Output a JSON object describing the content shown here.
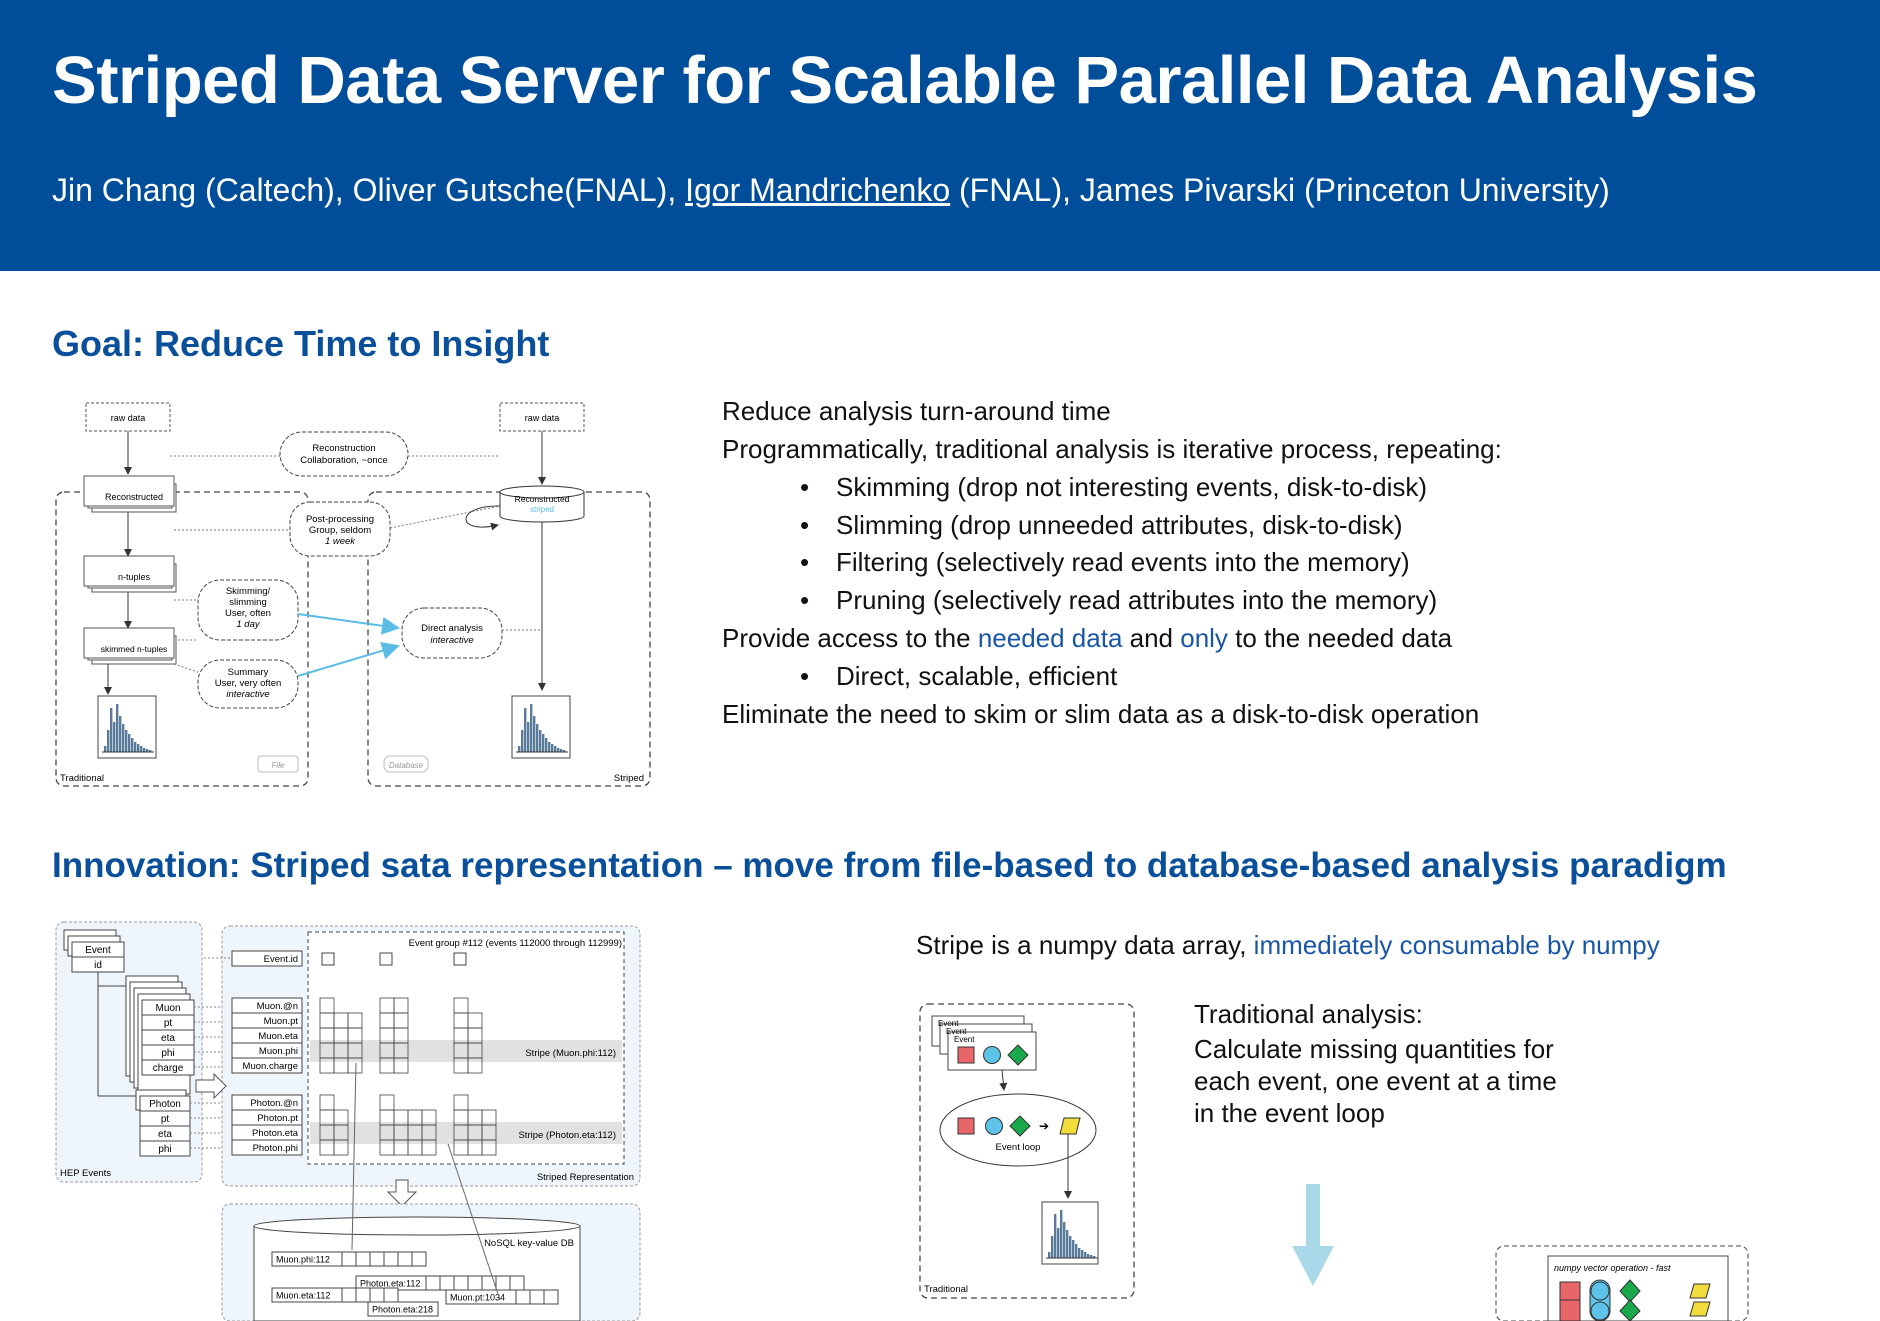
{
  "header": {
    "title": "Striped Data Server for Scalable Parallel Data Analysis",
    "authors_pre": "Jin Chang (Caltech), Oliver Gutsche(FNAL), ",
    "authors_presenter": "Igor Mandrichenko",
    "authors_post": " (FNAL), James Pivarski (Princeton University)"
  },
  "goal": {
    "heading": "Goal: Reduce Time to Insight",
    "line1": "Reduce analysis turn-around time",
    "line2": "Programmatically, traditional analysis is iterative process, repeating:",
    "bullets": [
      "Skimming (drop not interesting events, disk-to-disk)",
      "Slimming (drop unneeded attributes, disk-to-disk)",
      "Filtering (selectively read events into the memory)",
      "Pruning (selectively read attributes into the memory)"
    ],
    "access_a": "Provide access to the ",
    "access_b": "needed data",
    "access_c": " and ",
    "access_d": "only",
    "access_e": " to the needed data",
    "bullet2": "Direct, scalable, efficient",
    "line_last": "Eliminate the need to skim or slim data as a disk-to-disk operation",
    "diagram": {
      "raw_left": "raw data",
      "raw_right": "raw data",
      "reco_collab_1": "Reconstruction",
      "reco_collab_2": "Collaboration, ~once",
      "reconstructed": "Reconstructed",
      "reconstructed_right": "Reconstructed",
      "striped": "striped",
      "post_1": "Post-processing",
      "post_2": "Group, seldom",
      "post_3": "1 week",
      "ntuples": "n-tuples",
      "skim_1": "Skimming/",
      "skim_2": "slimming",
      "skim_3": "User, often",
      "skim_4": "1 day",
      "direct_1": "Direct analysis",
      "direct_2": "interactive",
      "skimmed": "skimmed n-tuples",
      "summary_1": "Summary",
      "summary_2": "User, very often",
      "summary_3": "interactive",
      "file": "File",
      "database": "Database",
      "traditional": "Traditional",
      "striped_label": "Striped"
    }
  },
  "innovation": {
    "heading": "Innovation: Striped sata representation – move from file-based to database-based analysis paradigm",
    "stripe_a": "Stripe is a numpy data array, ",
    "stripe_b": "immediately consumable by numpy",
    "trad_title": "Traditional analysis:",
    "trad_1": "Calculate missing quantities for",
    "trad_2": "each event, one event at a time",
    "trad_3": "in the event loop",
    "diagram": {
      "event": "Event",
      "id": "id",
      "muon_fields": [
        "Muon",
        "pt",
        "eta",
        "phi",
        "charge"
      ],
      "photon_fields": [
        "Photon",
        "pt",
        "eta",
        "phi"
      ],
      "hep_events": "HEP Events",
      "event_id": "Event.id",
      "muon_cols": [
        "Muon.@n",
        "Muon.pt",
        "Muon.eta",
        "Muon.phi",
        "Muon.charge"
      ],
      "photon_cols": [
        "Photon.@n",
        "Photon.pt",
        "Photon.eta",
        "Photon.phi"
      ],
      "event_group": "Event group #112 (events 112000 through 112999)",
      "stripe_muon": "Stripe (Muon.phi:112)",
      "stripe_photon": "Stripe (Photon.eta:112)",
      "striped_rep": "Striped Representation",
      "nosql": "NoSQL key-value DB",
      "db_keys": [
        "Muon.phi:112",
        "Photon.eta:112",
        "Muon.eta:112",
        "Muon.pt:1034",
        "Photon.eta:218"
      ],
      "event_loop": "Event loop",
      "traditional": "Traditional",
      "numpy_op": "numpy vector operation - fast"
    }
  },
  "colors": {
    "banner": "#004d99",
    "heading": "#0a4f9a",
    "highlight": "#1a56a6",
    "arrow_blue": "#5bbde6",
    "red": "#e8656a",
    "cyan": "#5ec3e8",
    "green": "#1aa84c",
    "yellow": "#f2dc3b"
  }
}
